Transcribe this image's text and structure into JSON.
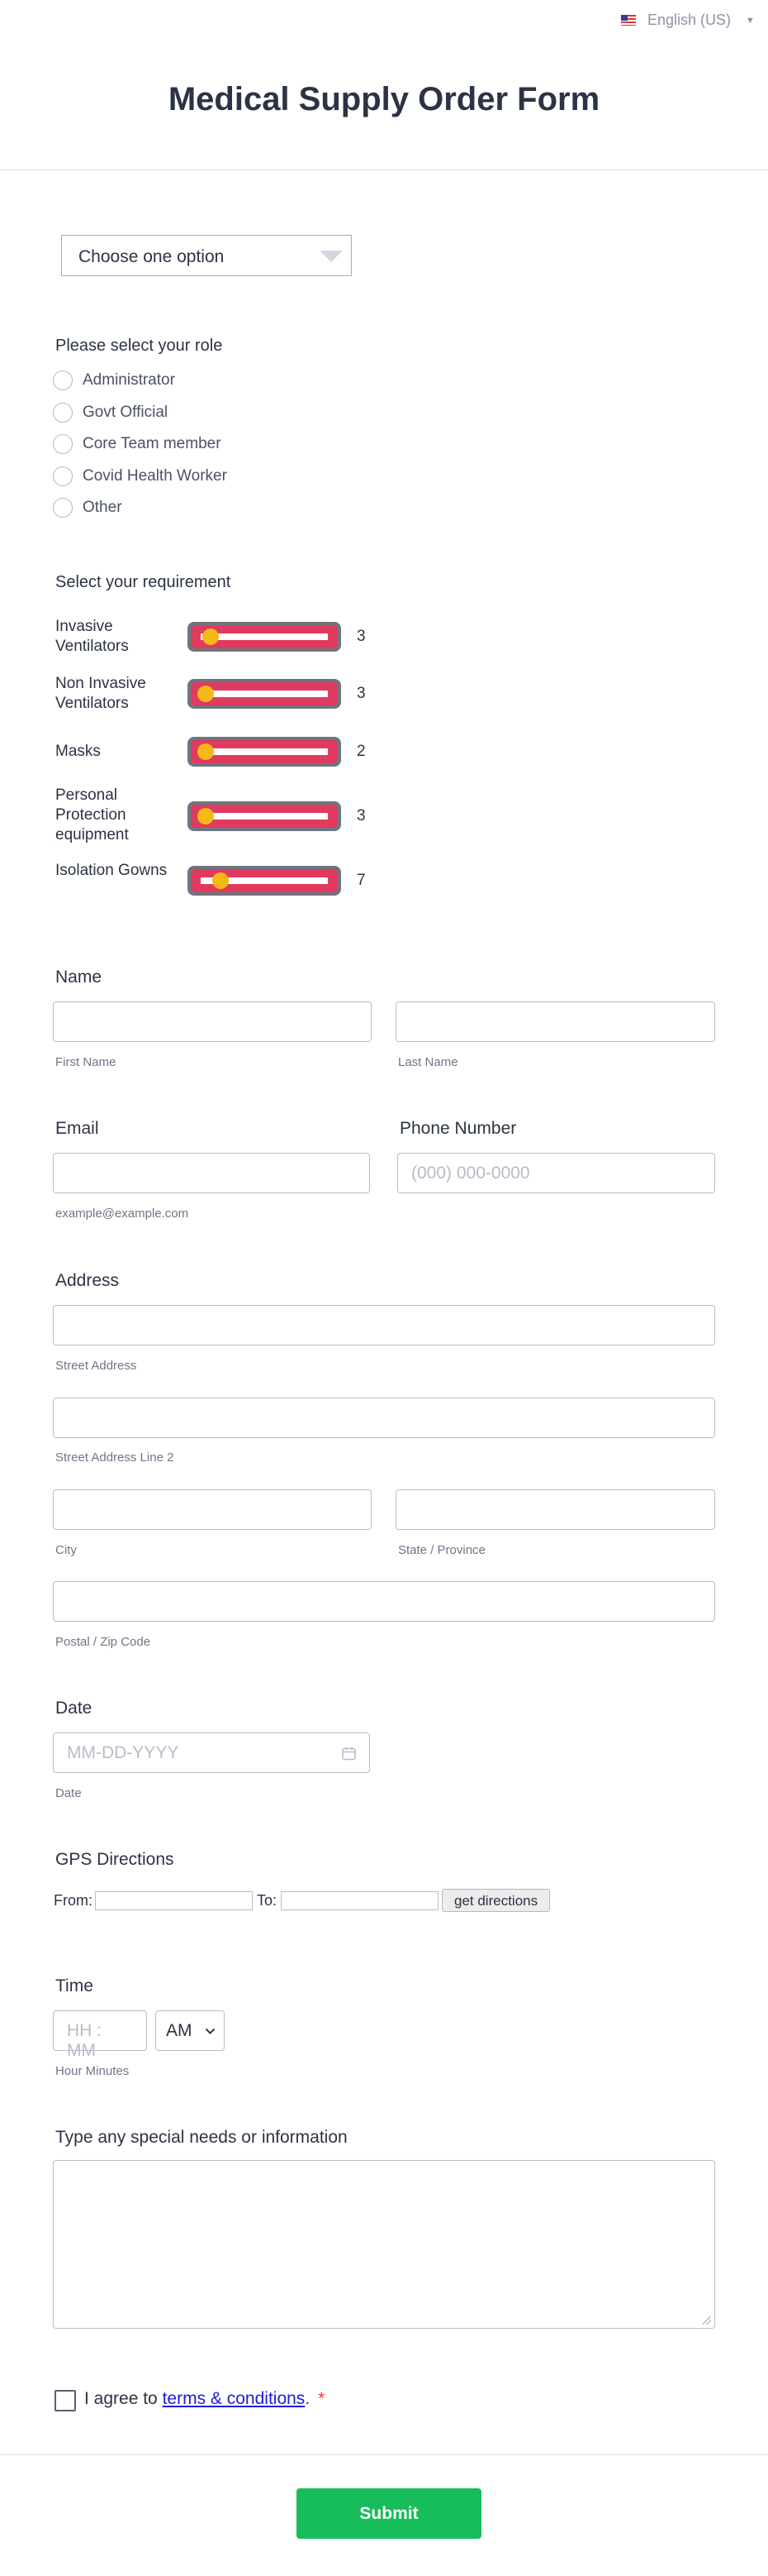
{
  "language": {
    "label": "English (US)"
  },
  "form": {
    "title": "Medical Supply Order Form"
  },
  "dropdown": {
    "selected": "Choose one option"
  },
  "role": {
    "label": "Please select your role",
    "options": [
      "Administrator",
      "Govt Official",
      "Core Team member",
      "Covid Health Worker",
      "Other"
    ]
  },
  "requirement": {
    "label": "Select your requirement",
    "items": [
      {
        "label": "Invasive Ventilators",
        "value": "3",
        "level": 0.04
      },
      {
        "label": "Non Invasive Ventilators",
        "value": "3",
        "level": 0.0
      },
      {
        "label": "Masks",
        "value": "2",
        "level": 0.0
      },
      {
        "label": "Personal Protection equipment",
        "value": "3",
        "level": 0.0
      },
      {
        "label": "Isolation Gowns",
        "value": "7",
        "level": 0.13
      }
    ]
  },
  "name": {
    "label": "Name",
    "first_sub": "First Name",
    "last_sub": "Last Name"
  },
  "email": {
    "label": "Email",
    "sub": "example@example.com"
  },
  "phone": {
    "label": "Phone Number",
    "placeholder": "(000) 000-0000"
  },
  "address": {
    "label": "Address",
    "street_sub": "Street Address",
    "street2_sub": "Street Address Line 2",
    "city_sub": "City",
    "state_sub": "State / Province",
    "zip_sub": "Postal / Zip Code"
  },
  "date": {
    "label": "Date",
    "placeholder": "MM-DD-YYYY",
    "sub": "Date",
    "icon": "calendar-icon"
  },
  "gps": {
    "label": "GPS Directions",
    "from": "From:",
    "to": "To:",
    "button": "get directions"
  },
  "time": {
    "label": "Time",
    "placeholder": "HH : MM",
    "ampm": "AM",
    "sub": "Hour Minutes"
  },
  "notes": {
    "label": "Type any special needs or information"
  },
  "terms": {
    "prefix": "I agree to ",
    "link": "terms & conditions",
    "suffix": ".",
    "required": "*"
  },
  "submit": {
    "label": "Submit"
  },
  "colors": {
    "accent": "#18bd5b",
    "slider_fill": "#e03a5f",
    "slider_thumb": "#f6b817",
    "required": "#f23a3c"
  }
}
